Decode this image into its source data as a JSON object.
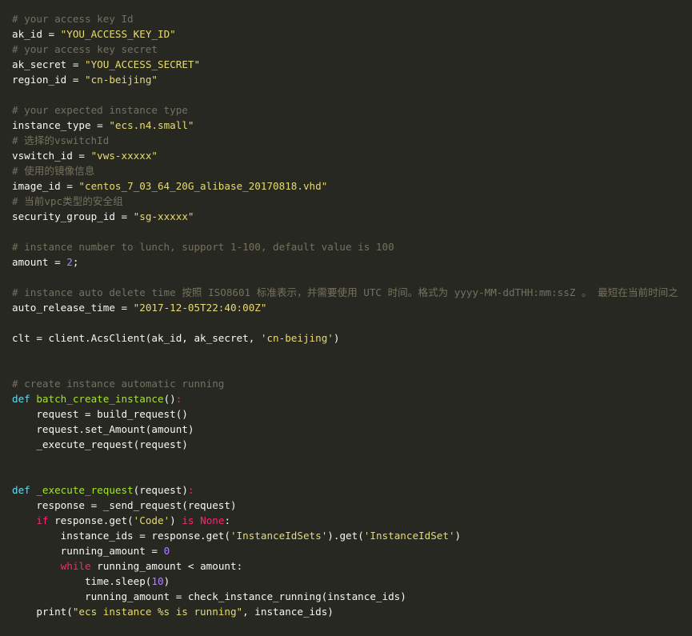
{
  "editor": {
    "theme_colors": {
      "background": "#272822",
      "text": "#f8f8f2",
      "comment": "#75715e",
      "string": "#e6db74",
      "keyword": "#f92672",
      "def_keyword": "#66d9ef",
      "function_name": "#a6e22e",
      "number": "#ae81ff"
    },
    "lines": [
      [
        {
          "t": "comment",
          "v": "# your access key Id"
        }
      ],
      [
        {
          "t": "plain",
          "v": "ak_id = "
        },
        {
          "t": "string",
          "v": "\"YOU_ACCESS_KEY_ID\""
        }
      ],
      [
        {
          "t": "comment",
          "v": "# your access key secret"
        }
      ],
      [
        {
          "t": "plain",
          "v": "ak_secret = "
        },
        {
          "t": "string",
          "v": "\"YOU_ACCESS_SECRET\""
        }
      ],
      [
        {
          "t": "plain",
          "v": "region_id = "
        },
        {
          "t": "string",
          "v": "\"cn-beijing\""
        }
      ],
      [],
      [
        {
          "t": "comment",
          "v": "# your expected instance type"
        }
      ],
      [
        {
          "t": "plain",
          "v": "instance_type = "
        },
        {
          "t": "string",
          "v": "\"ecs.n4.small\""
        }
      ],
      [
        {
          "t": "comment",
          "v": "# 选择的vswitchId"
        }
      ],
      [
        {
          "t": "plain",
          "v": "vswitch_id = "
        },
        {
          "t": "string",
          "v": "\"vws-xxxxx\""
        }
      ],
      [
        {
          "t": "comment",
          "v": "# 使用的镜像信息"
        }
      ],
      [
        {
          "t": "plain",
          "v": "image_id = "
        },
        {
          "t": "string",
          "v": "\"centos_7_03_64_20G_alibase_20170818.vhd\""
        }
      ],
      [
        {
          "t": "comment",
          "v": "# 当前vpc类型的安全组"
        }
      ],
      [
        {
          "t": "plain",
          "v": "security_group_id = "
        },
        {
          "t": "string",
          "v": "\"sg-xxxxx\""
        }
      ],
      [],
      [
        {
          "t": "comment",
          "v": "# instance number to lunch, support 1-100, default value is 100"
        }
      ],
      [
        {
          "t": "plain",
          "v": "amount = "
        },
        {
          "t": "number",
          "v": "2"
        },
        {
          "t": "plain",
          "v": ";"
        }
      ],
      [],
      [
        {
          "t": "comment",
          "v": "# instance auto delete time 按照 ISO8601 标准表示，并需要使用 UTC 时间。格式为 yyyy-MM-ddTHH:mm:ssZ 。 最短在当前时间之"
        }
      ],
      [
        {
          "t": "plain",
          "v": "auto_release_time = "
        },
        {
          "t": "string",
          "v": "\"2017-12-05T22:40:00Z\""
        }
      ],
      [],
      [
        {
          "t": "plain",
          "v": "clt = client.AcsClient(ak_id, ak_secret, "
        },
        {
          "t": "string",
          "v": "'cn-beijing'"
        },
        {
          "t": "plain",
          "v": ")"
        }
      ],
      [],
      [],
      [
        {
          "t": "comment",
          "v": "# create instance automatic running"
        }
      ],
      [
        {
          "t": "def",
          "v": "def "
        },
        {
          "t": "funcname",
          "v": "batch_create_instance"
        },
        {
          "t": "plain",
          "v": "()"
        },
        {
          "t": "keyword",
          "v": ":"
        }
      ],
      [
        {
          "t": "plain",
          "v": "    request = build_request()"
        }
      ],
      [
        {
          "t": "plain",
          "v": "    request.set_Amount(amount)"
        }
      ],
      [
        {
          "t": "plain",
          "v": "    _execute_request(request)"
        }
      ],
      [],
      [],
      [
        {
          "t": "def",
          "v": "def "
        },
        {
          "t": "funcname",
          "v": "_execute_request"
        },
        {
          "t": "plain",
          "v": "(request)"
        },
        {
          "t": "keyword",
          "v": ":"
        }
      ],
      [
        {
          "t": "plain",
          "v": "    response = _send_request(request)"
        }
      ],
      [
        {
          "t": "plain",
          "v": "    "
        },
        {
          "t": "keyword",
          "v": "if"
        },
        {
          "t": "plain",
          "v": " response.get("
        },
        {
          "t": "string",
          "v": "'Code'"
        },
        {
          "t": "plain",
          "v": ") "
        },
        {
          "t": "keyword",
          "v": "is"
        },
        {
          "t": "plain",
          "v": " "
        },
        {
          "t": "keyword",
          "v": "None"
        },
        {
          "t": "plain",
          "v": ":"
        }
      ],
      [
        {
          "t": "plain",
          "v": "        instance_ids = response.get("
        },
        {
          "t": "string",
          "v": "'InstanceIdSets'"
        },
        {
          "t": "plain",
          "v": ").get("
        },
        {
          "t": "string",
          "v": "'InstanceIdSet'"
        },
        {
          "t": "plain",
          "v": ")"
        }
      ],
      [
        {
          "t": "plain",
          "v": "        running_amount = "
        },
        {
          "t": "number",
          "v": "0"
        }
      ],
      [
        {
          "t": "plain",
          "v": "        "
        },
        {
          "t": "keyword",
          "v": "while"
        },
        {
          "t": "plain",
          "v": " running_amount < amount:"
        }
      ],
      [
        {
          "t": "plain",
          "v": "            time.sleep("
        },
        {
          "t": "number",
          "v": "10"
        },
        {
          "t": "plain",
          "v": ")"
        }
      ],
      [
        {
          "t": "plain",
          "v": "            running_amount = check_instance_running(instance_ids)"
        }
      ],
      [
        {
          "t": "plain",
          "v": "    print("
        },
        {
          "t": "string",
          "v": "\"ecs instance %s is running\""
        },
        {
          "t": "plain",
          "v": ", instance_ids)"
        }
      ]
    ]
  }
}
